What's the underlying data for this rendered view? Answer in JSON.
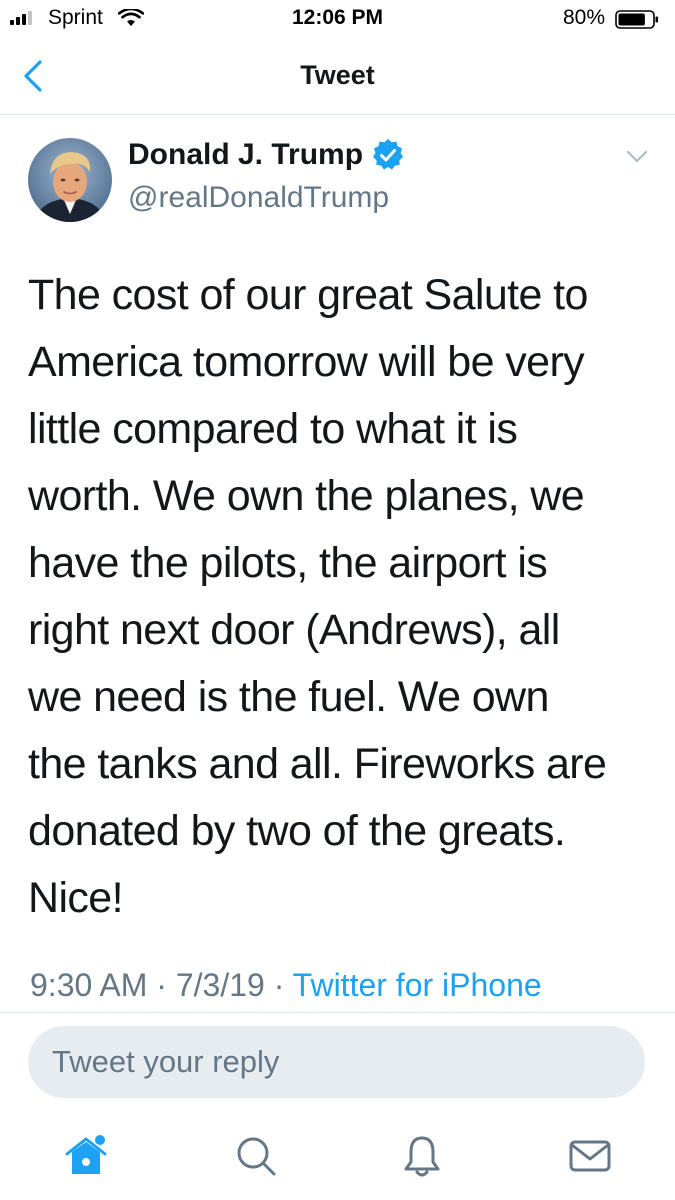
{
  "status_bar": {
    "carrier": "Sprint",
    "time": "12:06 PM",
    "battery": "80%",
    "battery_level": 0.8,
    "signal_bars": 3
  },
  "nav": {
    "title": "Tweet",
    "back_icon": "chevron-left-icon"
  },
  "tweet": {
    "display_name": "Donald J. Trump",
    "handle": "@realDonaldTrump",
    "verified": true,
    "text_lines": [
      "The cost of our great Salute to",
      "America tomorrow will be very",
      "little compared to what it is",
      "worth. We own the planes, we",
      "have the pilots, the airport is",
      "right next door (Andrews), all",
      "we need is the fuel. We own",
      "the tanks and all. Fireworks are",
      "donated by two of the greats.",
      "Nice!"
    ],
    "time": "9:30 AM",
    "date": "7/3/19",
    "source": "Twitter for iPhone"
  },
  "reply": {
    "placeholder": "Tweet your reply"
  },
  "tab_bar": {
    "tabs": [
      "home-icon",
      "search-icon",
      "notifications-icon",
      "messages-icon"
    ]
  },
  "colors": {
    "accent": "#1da1f2",
    "secondary_text": "#657786",
    "reply_bg": "#e6ecf0"
  }
}
